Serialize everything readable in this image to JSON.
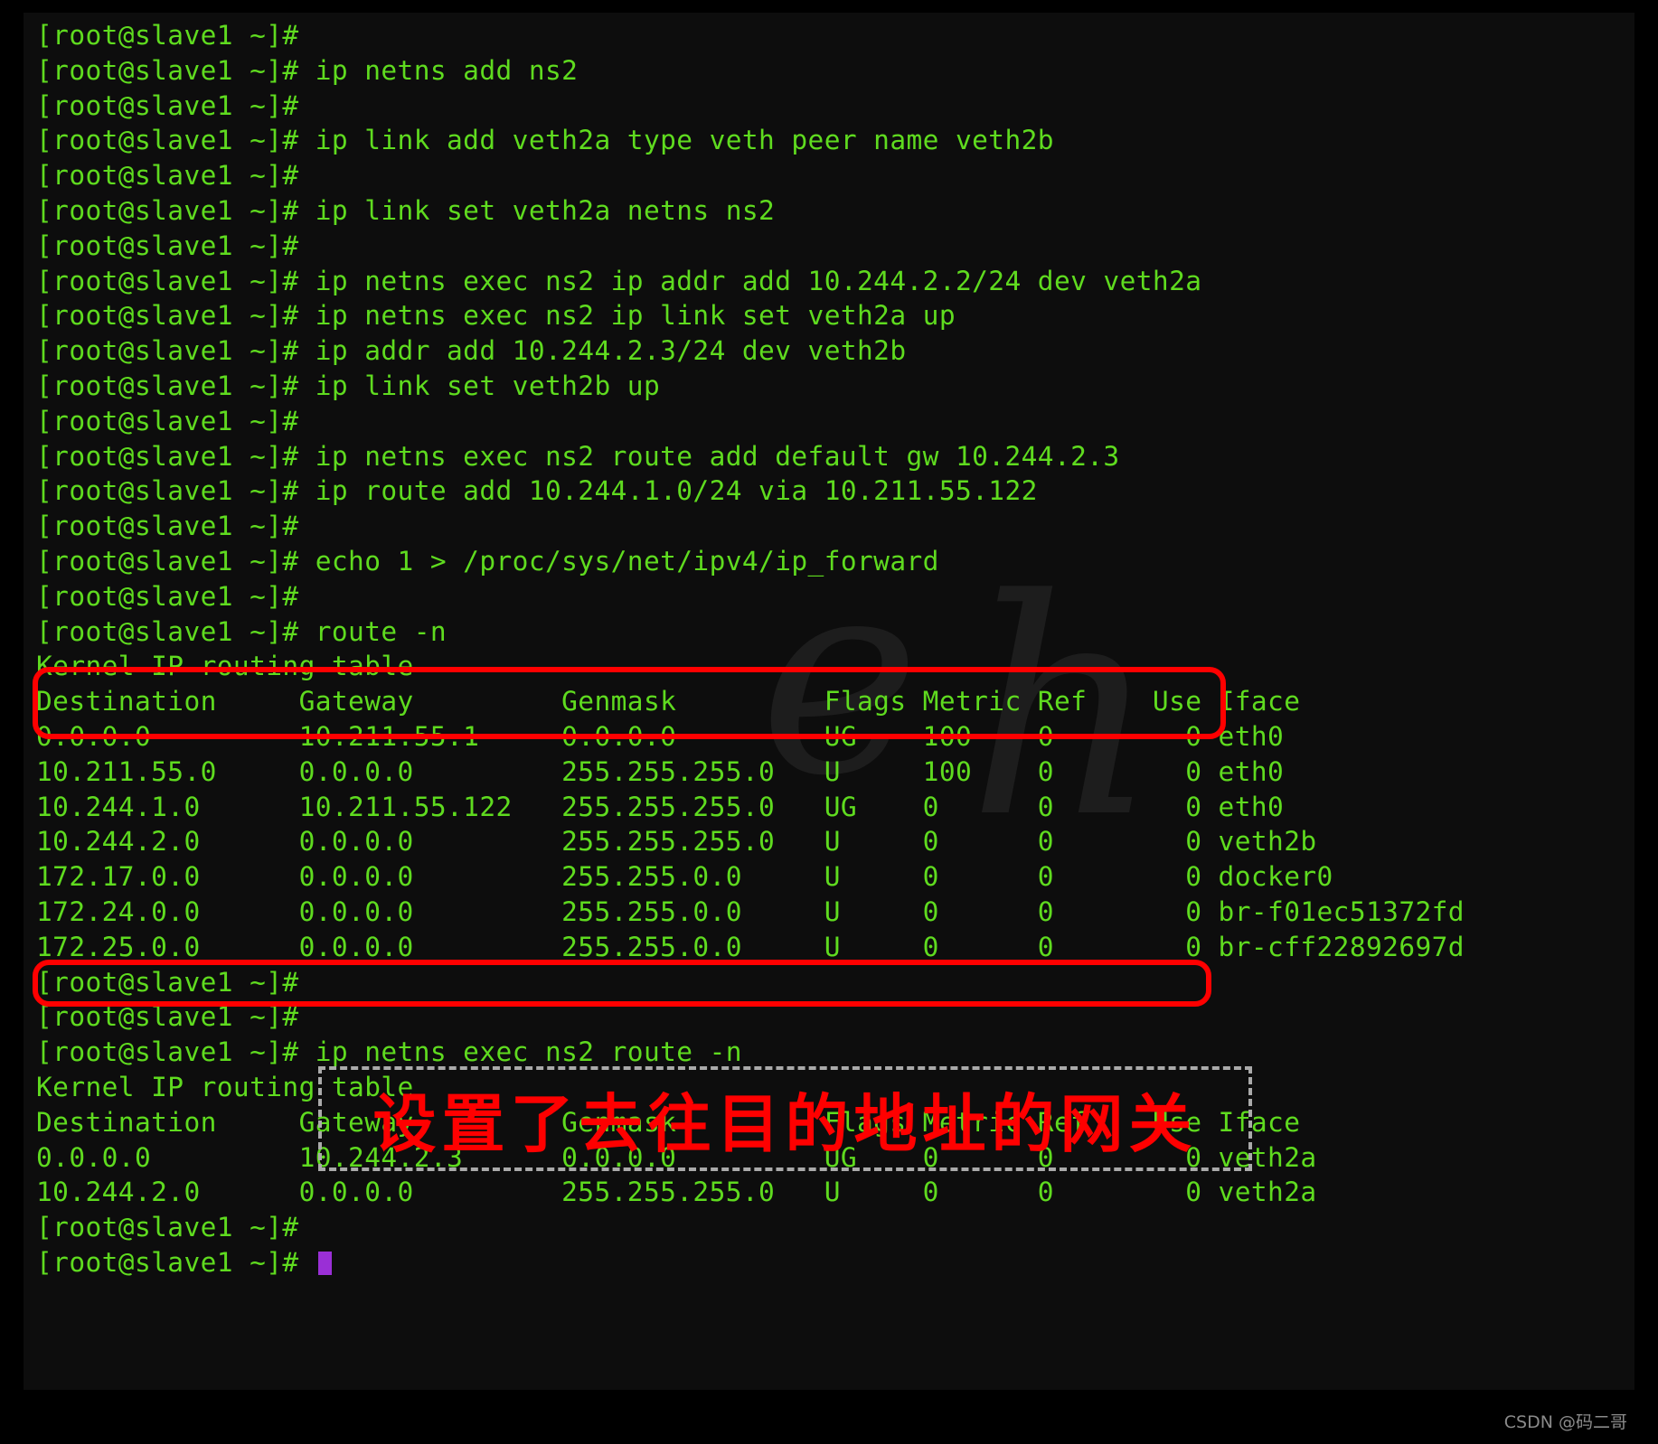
{
  "terminal": {
    "prompt": "[root@slave1 ~]# ",
    "lines": [
      {
        "type": "prompt",
        "command": ""
      },
      {
        "type": "prompt",
        "command": "ip netns add ns2"
      },
      {
        "type": "prompt",
        "command": ""
      },
      {
        "type": "prompt",
        "command": "ip link add veth2a type veth peer name veth2b"
      },
      {
        "type": "prompt",
        "command": ""
      },
      {
        "type": "prompt",
        "command": "ip link set veth2a netns ns2"
      },
      {
        "type": "prompt",
        "command": ""
      },
      {
        "type": "prompt",
        "command": "ip netns exec ns2 ip addr add 10.244.2.2/24 dev veth2a"
      },
      {
        "type": "prompt",
        "command": "ip netns exec ns2 ip link set veth2a up"
      },
      {
        "type": "prompt",
        "command": "ip addr add 10.244.2.3/24 dev veth2b"
      },
      {
        "type": "prompt",
        "command": "ip link set veth2b up"
      },
      {
        "type": "prompt",
        "command": ""
      },
      {
        "type": "prompt",
        "command": "ip netns exec ns2 route add default gw 10.244.2.3"
      },
      {
        "type": "prompt",
        "command": "ip route add 10.244.1.0/24 via 10.211.55.122"
      },
      {
        "type": "prompt",
        "command": ""
      },
      {
        "type": "prompt",
        "command": "echo 1 > /proc/sys/net/ipv4/ip_forward"
      },
      {
        "type": "prompt",
        "command": ""
      },
      {
        "type": "prompt",
        "command": "route -n"
      },
      {
        "type": "output",
        "text": "Kernel IP routing table"
      },
      {
        "type": "output",
        "text": "Destination     Gateway         Genmask         Flags Metric Ref    Use Iface"
      },
      {
        "type": "output",
        "text": "0.0.0.0         10.211.55.1     0.0.0.0         UG    100    0        0 eth0"
      },
      {
        "type": "output",
        "text": "10.211.55.0     0.0.0.0         255.255.255.0   U     100    0        0 eth0"
      },
      {
        "type": "output",
        "text": "10.244.1.0      10.211.55.122   255.255.255.0   UG    0      0        0 eth0"
      },
      {
        "type": "output",
        "text": "10.244.2.0      0.0.0.0         255.255.255.0   U     0      0        0 veth2b"
      },
      {
        "type": "output",
        "text": "172.17.0.0      0.0.0.0         255.255.0.0     U     0      0        0 docker0"
      },
      {
        "type": "output",
        "text": "172.24.0.0      0.0.0.0         255.255.0.0     U     0      0        0 br-f01ec51372fd"
      },
      {
        "type": "output",
        "text": "172.25.0.0      0.0.0.0         255.255.0.0     U     0      0        0 br-cff22892697d"
      },
      {
        "type": "prompt",
        "command": ""
      },
      {
        "type": "prompt",
        "command": ""
      },
      {
        "type": "prompt",
        "command": "ip netns exec ns2 route -n"
      },
      {
        "type": "output",
        "text": "Kernel IP routing table"
      },
      {
        "type": "output",
        "text": "Destination     Gateway         Genmask         Flags Metric Ref    Use Iface"
      },
      {
        "type": "output",
        "text": "0.0.0.0         10.244.2.3      0.0.0.0         UG    0      0        0 veth2a"
      },
      {
        "type": "output",
        "text": "10.244.2.0      0.0.0.0         255.255.255.0   U     0      0        0 veth2a"
      },
      {
        "type": "prompt",
        "command": ""
      },
      {
        "type": "prompt-cursor",
        "command": ""
      }
    ],
    "route_table_1": {
      "title": "Kernel IP routing table",
      "headers": [
        "Destination",
        "Gateway",
        "Genmask",
        "Flags",
        "Metric",
        "Ref",
        "Use",
        "Iface"
      ],
      "rows": [
        [
          "0.0.0.0",
          "10.211.55.1",
          "0.0.0.0",
          "UG",
          "100",
          "0",
          "0",
          "eth0"
        ],
        [
          "10.211.55.0",
          "0.0.0.0",
          "255.255.255.0",
          "U",
          "100",
          "0",
          "0",
          "eth0"
        ],
        [
          "10.244.1.0",
          "10.211.55.122",
          "255.255.255.0",
          "UG",
          "0",
          "0",
          "0",
          "eth0"
        ],
        [
          "10.244.2.0",
          "0.0.0.0",
          "255.255.255.0",
          "U",
          "0",
          "0",
          "0",
          "veth2b"
        ],
        [
          "172.17.0.0",
          "0.0.0.0",
          "255.255.0.0",
          "U",
          "0",
          "0",
          "0",
          "docker0"
        ],
        [
          "172.24.0.0",
          "0.0.0.0",
          "255.255.0.0",
          "U",
          "0",
          "0",
          "0",
          "br-f01ec51372fd"
        ],
        [
          "172.25.0.0",
          "0.0.0.0",
          "255.255.0.0",
          "U",
          "0",
          "0",
          "0",
          "br-cff22892697d"
        ]
      ]
    },
    "route_table_2": {
      "title": "Kernel IP routing table",
      "headers": [
        "Destination",
        "Gateway",
        "Genmask",
        "Flags",
        "Metric",
        "Ref",
        "Use",
        "Iface"
      ],
      "rows": [
        [
          "0.0.0.0",
          "10.244.2.3",
          "0.0.0.0",
          "UG",
          "0",
          "0",
          "0",
          "veth2a"
        ],
        [
          "10.244.2.0",
          "0.0.0.0",
          "255.255.255.0",
          "U",
          "0",
          "0",
          "0",
          "veth2a"
        ]
      ]
    }
  },
  "annotation": {
    "text": "设置了去往目的地址的网关",
    "color": "#ff0000",
    "highlight_color": "#ff0000"
  },
  "watermark": {
    "text": "CSDN @码二哥",
    "background_glyph": "he"
  },
  "colors": {
    "terminal_text": "#5fdb1f",
    "terminal_bg": "#0d0d0d",
    "cursor": "#9a2fd6",
    "highlight": "#ff0000",
    "annotation_border": "#aaaaaa"
  }
}
